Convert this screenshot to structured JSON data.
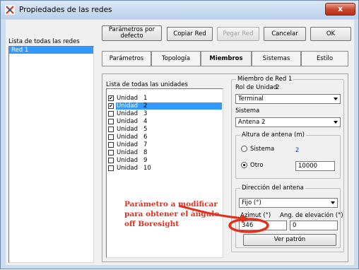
{
  "window": {
    "title": "Propiedades de las redes",
    "close_label": "x"
  },
  "toolbar": {
    "defaults_label": "Parámetros por defecto",
    "copy_label": "Copiar Red",
    "paste_label": "Pegar Red",
    "cancel_label": "Cancelar",
    "ok_label": "OK"
  },
  "networks": {
    "header": "Lista de todas las redes",
    "items": [
      "Red 1"
    ]
  },
  "tabs": [
    "Parámetros",
    "Topología",
    "Miembros",
    "Sistemas",
    "Estilo"
  ],
  "units": {
    "header": "Lista de todas las unidades",
    "items": [
      {
        "label": "Unidad",
        "num": "1",
        "checked": true
      },
      {
        "label": "Unidad",
        "num": "2",
        "checked": true
      },
      {
        "label": "Unidad",
        "num": "3",
        "checked": false
      },
      {
        "label": "Unidad",
        "num": "4",
        "checked": false
      },
      {
        "label": "Unidad",
        "num": "5",
        "checked": false
      },
      {
        "label": "Unidad",
        "num": "6",
        "checked": false
      },
      {
        "label": "Unidad",
        "num": "7",
        "checked": false
      },
      {
        "label": "Unidad",
        "num": "8",
        "checked": false
      },
      {
        "label": "Unidad",
        "num": "9",
        "checked": false
      },
      {
        "label": "Unidad",
        "num": "10",
        "checked": false
      }
    ]
  },
  "member": {
    "group_title": "Miembro de Red 1",
    "role_label": "Rol de Unidad",
    "role_value": "2",
    "role_select": "Terminal",
    "system_label": "Sistema",
    "system_select": "Antena 2",
    "height": {
      "title": "Altura de antena (m)",
      "system_option": "Sistema",
      "system_value": "2",
      "other_option": "Otro",
      "other_value": "10000"
    },
    "direction": {
      "title": "Dirección del antena",
      "mode_select": "Fijo (°)",
      "azimuth_label": "Azimut (°)",
      "elevation_label": "Ang. de elevación (°)",
      "azimuth_value": "346",
      "elevation_value": "0",
      "pattern_button": "Ver patrón"
    }
  },
  "annotation": {
    "text": "Parámetro a modificar para obtener el ángulo off Boresight",
    "color": "#e0301e"
  },
  "colors": {
    "selection": "#3399ff",
    "title_bar": "#c9dcf0"
  }
}
